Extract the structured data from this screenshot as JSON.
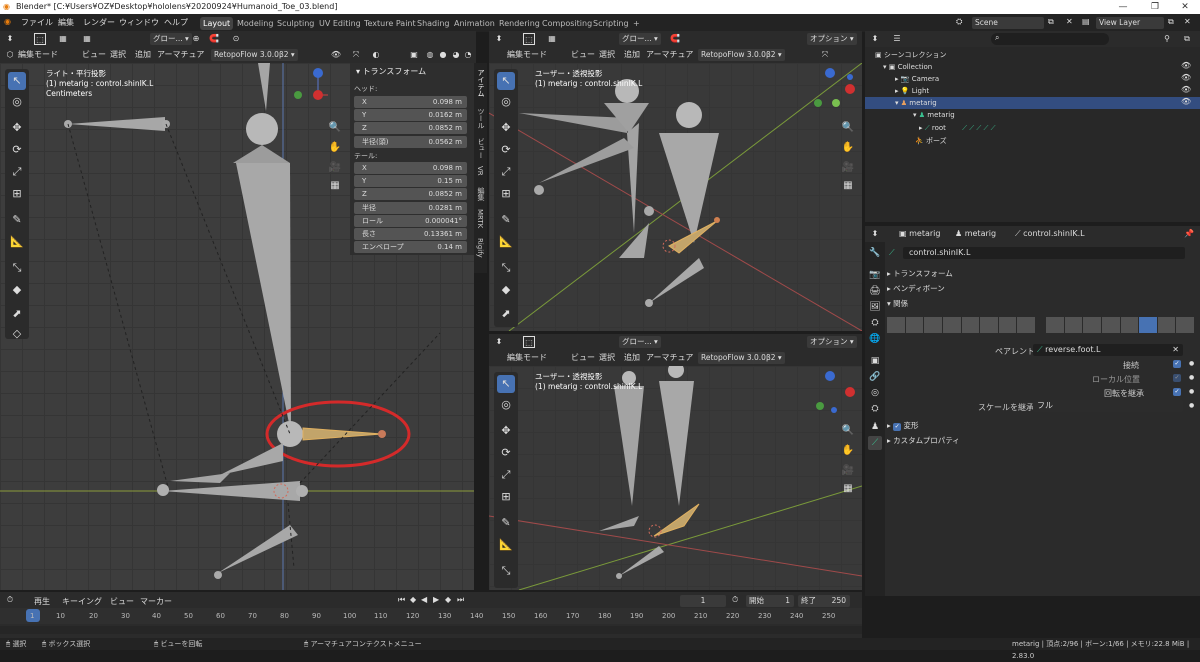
{
  "title_bar": {
    "title": "Blender* [C:¥Users¥OZ¥Desktop¥hololens¥20200924¥Humanoid_Toe_03.blend]"
  },
  "menu": [
    "ファイル",
    "編集",
    "レンダー",
    "ウィンドウ",
    "ヘルプ"
  ],
  "workspaces": [
    "Layout",
    "Modeling",
    "Sculpting",
    "UV Editing",
    "Texture Paint",
    "Shading",
    "Animation",
    "Rendering",
    "Compositing",
    "Scripting"
  ],
  "scene": {
    "name": "Scene",
    "view_layer": "View Layer"
  },
  "viewport_header": {
    "mode": "編集モード",
    "view": "ビュー",
    "select": "選択",
    "add": "追加",
    "armature": "アーマチュア",
    "addon": "RetopoFlow 3.0.0β2",
    "transform_orient": "グロー...",
    "options": "オプション"
  },
  "viewport_left": {
    "line1": "ライト・平行投影",
    "line2": "(1) metarig : control.shinIK.L",
    "line3": "Centimeters"
  },
  "viewport_tr": {
    "line1": "ユーザー・透視投影",
    "line2": "(1) metarig : control.shinIK.L"
  },
  "viewport_br": {
    "line1": "ユーザー・透視投影",
    "line2": "(1) metarig : control.shinIK.L"
  },
  "npanel": {
    "title": "トランスフォーム",
    "head_label": "ヘッド:",
    "head": [
      {
        "l": "X",
        "v": "0.098 m"
      },
      {
        "l": "Y",
        "v": "0.0162 m"
      },
      {
        "l": "Z",
        "v": "0.0852 m"
      }
    ],
    "head_radius": {
      "l": "半径(頭)",
      "v": "0.0562 m"
    },
    "tail_label": "テール:",
    "tail": [
      {
        "l": "X",
        "v": "0.098 m"
      },
      {
        "l": "Y",
        "v": "0.15 m"
      },
      {
        "l": "Z",
        "v": "0.0852 m"
      }
    ],
    "extra": [
      {
        "l": "半径",
        "v": "0.0281 m"
      },
      {
        "l": "ロール",
        "v": "0.000041°"
      },
      {
        "l": "長さ",
        "v": "0.13361 m"
      },
      {
        "l": "エンベロープ",
        "v": "0.14 m"
      }
    ],
    "tabs": [
      "アイテム",
      "ツール",
      "ビュー",
      "VR",
      "編集",
      "MRTK",
      "Rigify"
    ]
  },
  "outliner": {
    "search_placeholder": "",
    "rows": [
      "シーンコレクション",
      "Collection",
      "Camera",
      "Light",
      "metarig",
      "metarig",
      "root",
      "ポーズ"
    ]
  },
  "properties": {
    "breadcrumb": [
      "metarig",
      "metarig",
      "control.shinIK.L"
    ],
    "bone_name": "control.shinIK.L",
    "sections": [
      "トランスフォーム",
      "ベンディボーン",
      "関係"
    ],
    "parent_label": "ペアレント",
    "parent_value": "reverse.foot.L",
    "connected": "接続",
    "local_location": "ローカル位置",
    "inherit_rotation": "回転を継承",
    "inherit_scale_label": "スケールを継承",
    "inherit_scale_value": "フル",
    "deform": "変形",
    "custom_props": "カスタムプロパティ"
  },
  "timeline": {
    "menu": [
      "再生",
      "キーイング",
      "ビュー",
      "マーカー"
    ],
    "current_frame": "1",
    "start_label": "開始",
    "start": "1",
    "end_label": "終了",
    "end": "250",
    "ticks": [
      "1",
      "10",
      "20",
      "30",
      "40",
      "50",
      "60",
      "70",
      "80",
      "90",
      "100",
      "110",
      "120",
      "130",
      "140",
      "150",
      "160",
      "170",
      "180",
      "190",
      "200",
      "210",
      "220",
      "230",
      "240",
      "250"
    ]
  },
  "statusbar": {
    "select": "選択",
    "box_select": "ボックス選択",
    "rotate_view": "ビューを回転",
    "context_menu": "アーマチュアコンテクストメニュー",
    "stats": "metarig | 頂点:2/96 | ボーン:1/66 | メモリ:22.8 MiB | 2.83.0"
  }
}
